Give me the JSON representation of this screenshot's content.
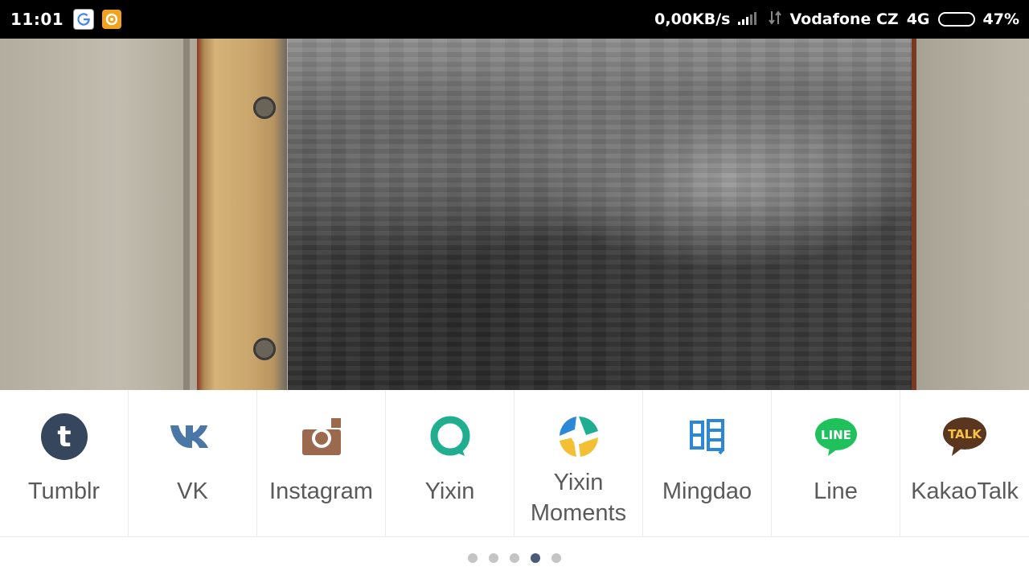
{
  "status_bar": {
    "time": "11:01",
    "notification_icons": [
      "google-icon",
      "camera-app-icon"
    ],
    "net_speed": "0,00KB/s",
    "carrier": "Vodafone CZ",
    "network_type": "4G",
    "battery_percent": "47%",
    "battery_level": 0.47,
    "battery_color": "#f4a21b"
  },
  "share_sheet": {
    "items": [
      {
        "label": "Tumblr",
        "icon": "tumblr-icon",
        "color": "#36465d"
      },
      {
        "label": "VK",
        "icon": "vk-icon",
        "color": "#4a76a8"
      },
      {
        "label": "Instagram",
        "icon": "instagram-icon",
        "color": "#9b6a4e"
      },
      {
        "label": "Yixin",
        "icon": "yixin-icon",
        "color": "#1fae8f"
      },
      {
        "label": "Yixin Moments",
        "icon": "yixin-moments-icon",
        "color": "#2b88d8"
      },
      {
        "label": "Mingdao",
        "icon": "mingdao-icon",
        "color": "#2b88d8"
      },
      {
        "label": "Line",
        "icon": "line-icon",
        "color": "#1fc15c"
      },
      {
        "label": "KakaoTalk",
        "icon": "kakaotalk-icon",
        "color": "#5a3520"
      }
    ],
    "pager": {
      "total": 5,
      "active_index": 3
    }
  }
}
